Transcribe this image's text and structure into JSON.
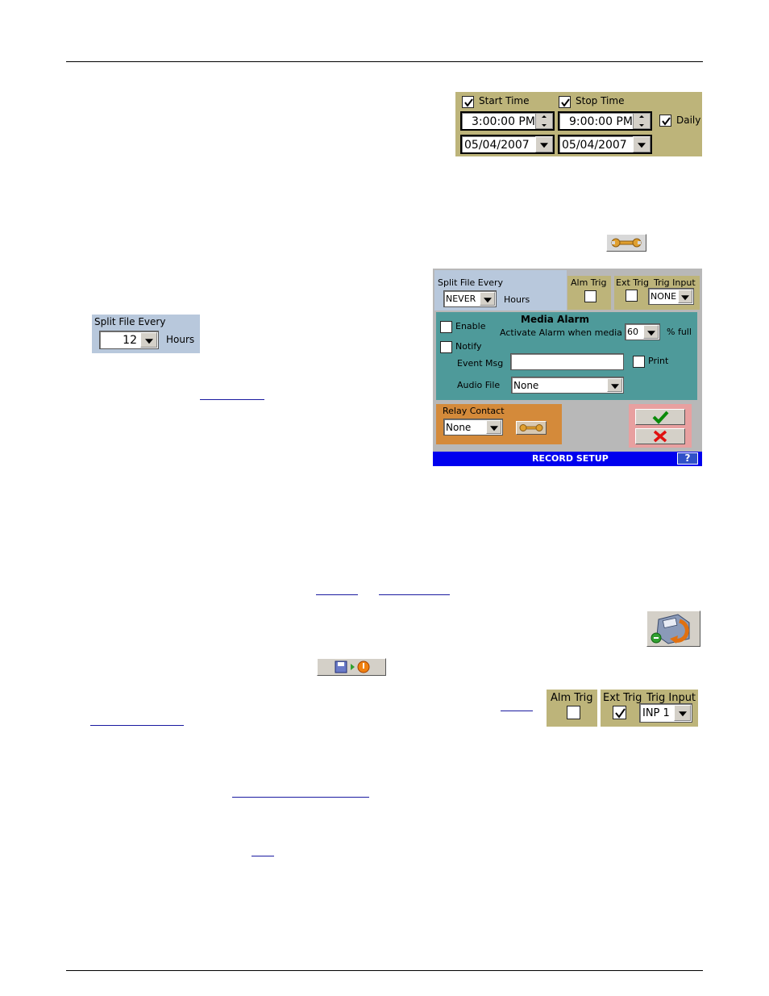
{
  "schedule": {
    "start_time_label": "Start Time",
    "stop_time_label": "Stop Time",
    "start_time": "3:00:00 PM",
    "stop_time": "9:00:00 PM",
    "daily_label": "Daily",
    "start_date": "05/04/2007",
    "stop_date": "05/04/2007"
  },
  "split_small": {
    "label": "Split File Every",
    "value": "12",
    "hours_label": "Hours"
  },
  "record_setup": {
    "split_label": "Split File Every",
    "split_value": "NEVER",
    "hours_label": "Hours",
    "alm_trig_label": "Alm Trig",
    "ext_trig_label": "Ext Trig",
    "trig_input_label": "Trig Input",
    "trig_input_value": "NONE",
    "enable_label": "Enable",
    "media_alarm_title": "Media Alarm",
    "activate_label": "Activate Alarm when media is",
    "percent_value": "60",
    "percent_full_label": "% full",
    "notify_label": "Notify",
    "event_msg_label": "Event Msg",
    "event_msg_value": "",
    "print_label": "Print",
    "audio_file_label": "Audio File",
    "audio_file_value": "None",
    "relay_contact_label": "Relay Contact",
    "relay_value": "None",
    "title_bar": "RECORD SETUP",
    "help_label": "?"
  },
  "trig_small": {
    "alm_trig_label": "Alm Trig",
    "ext_trig_label": "Ext Trig",
    "trig_input_label": "Trig Input",
    "trig_input_value": "INP 1"
  },
  "colors": {
    "khaki": "#bdb47a",
    "steel_blue": "#b8c8dc",
    "teal": "#4e9a9a",
    "orange": "#d48a3a",
    "pink": "#e8a0a0",
    "title_blue": "#0000ee"
  },
  "icons": [
    "wrench-icon",
    "save-file-icon",
    "save-restart-icon",
    "checkmark-icon",
    "x-icon"
  ]
}
